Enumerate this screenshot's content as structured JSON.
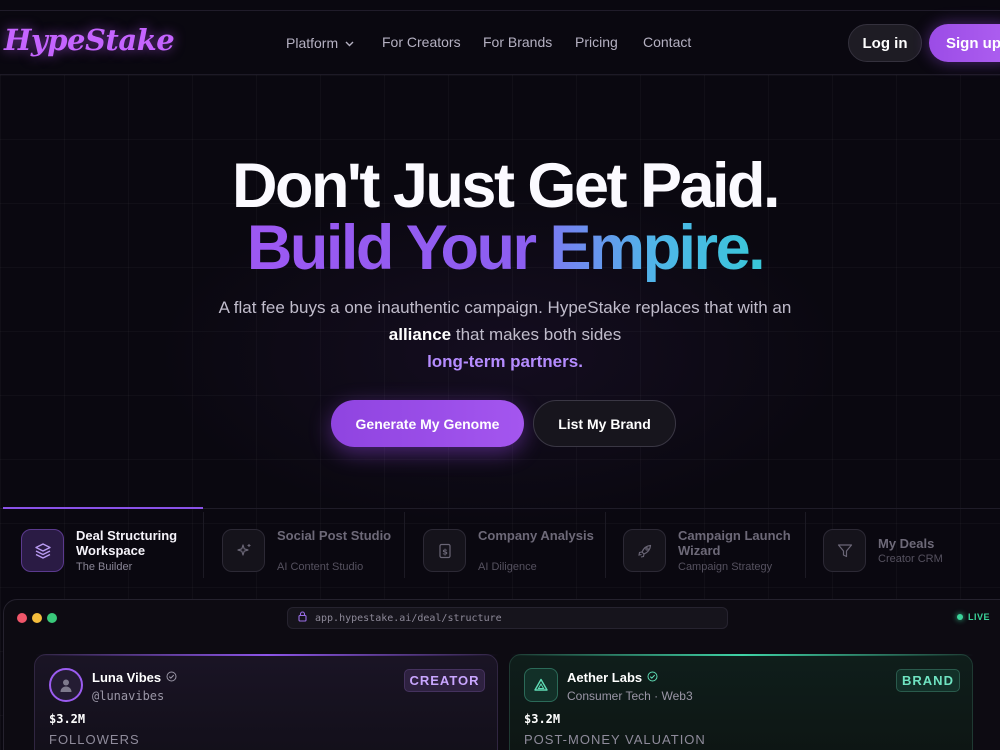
{
  "brand": {
    "logo_text": "HypeStake",
    "accent": "#c564ff"
  },
  "nav": {
    "items": [
      {
        "label": "Platform",
        "has_dropdown": true
      },
      {
        "label": "For Creators"
      },
      {
        "label": "For Brands"
      },
      {
        "label": "Pricing"
      },
      {
        "label": "Contact"
      }
    ],
    "login_label": "Log in",
    "signup_label": "Sign up"
  },
  "hero": {
    "headline_line1": "Don't Just Get Paid.",
    "headline_line2_part1": "Build Your ",
    "headline_line2_part2": "Empire.",
    "sub_part1": "A flat fee buys a one inauthentic campaign. HypeStake replaces that with an ",
    "sub_bold": "alliance",
    "sub_part2": " that makes both sides ",
    "sub_accent": "long-term partners.",
    "primary_cta": "Generate My Genome",
    "secondary_cta": "List My Brand"
  },
  "features": [
    {
      "title": "Deal Structuring Workspace",
      "desc": "The Builder",
      "icon": "layers-icon",
      "active": true
    },
    {
      "title": "Social Post Studio",
      "desc": "AI Content Studio",
      "icon": "sparkle-icon",
      "active": false
    },
    {
      "title": "Company Analysis",
      "desc": "AI Diligence",
      "icon": "dollar-doc-icon",
      "active": false
    },
    {
      "title": "Campaign Launch Wizard",
      "desc": "Campaign Strategy",
      "icon": "rocket-icon",
      "active": false
    },
    {
      "title": "My Deals",
      "desc": "Creator CRM",
      "icon": "filter-icon",
      "active": false
    }
  ],
  "app_window": {
    "url": "app.hypestake.ai/deal/structure",
    "status": "LIVE",
    "creator_card": {
      "name": "Luna Vibes",
      "handle": "@lunavibes",
      "badge": "CREATOR",
      "metric_value": "$3.2M",
      "metric_label": "FOLLOWERS"
    },
    "brand_card": {
      "name": "Aether Labs",
      "subtitle": "Consumer Tech · Web3",
      "badge": "BRAND",
      "metric_value": "$3.2M",
      "metric_label": "POST-MONEY VALUATION"
    }
  }
}
